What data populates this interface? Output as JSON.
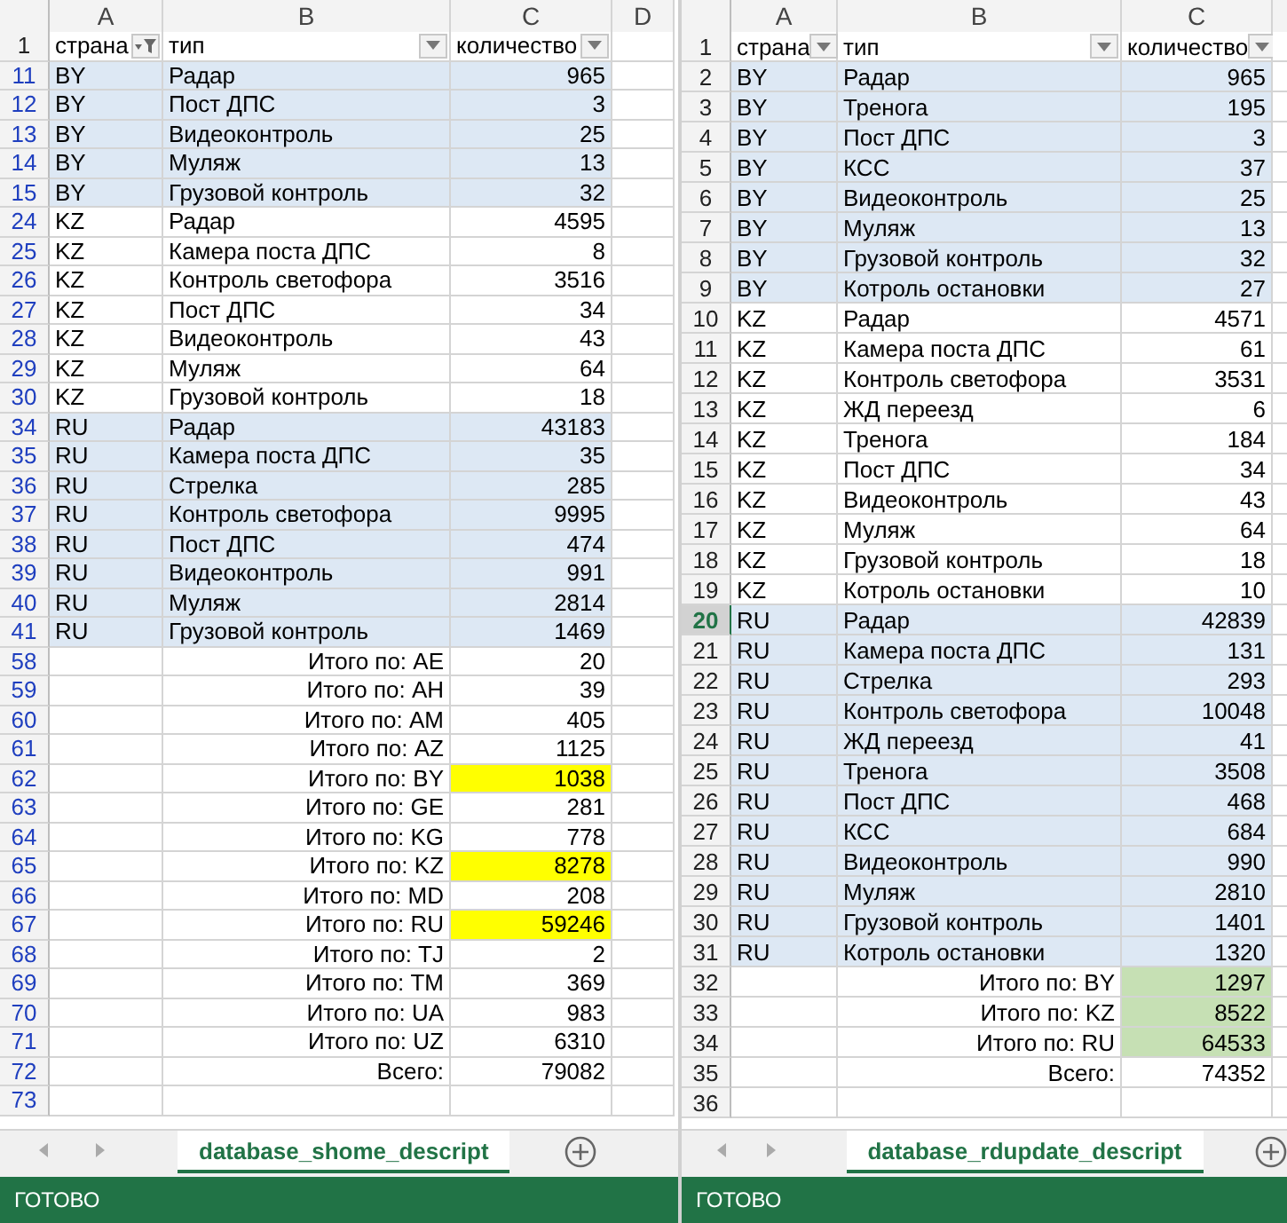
{
  "panes": [
    {
      "filtered": true,
      "column_letters": [
        "A",
        "B",
        "C",
        "D"
      ],
      "header": {
        "num": "1",
        "cells": [
          {
            "label": "страна",
            "filtered": true
          },
          {
            "label": "тип",
            "filtered": false
          },
          {
            "label": "количество",
            "filtered": false
          }
        ]
      },
      "rows": [
        {
          "num": "11",
          "kind": "data",
          "shaded": true,
          "selected": false,
          "country": "BY",
          "type": "Радар",
          "count": "965"
        },
        {
          "num": "12",
          "kind": "data",
          "shaded": true,
          "selected": false,
          "country": "BY",
          "type": "Пост ДПС",
          "count": "3"
        },
        {
          "num": "13",
          "kind": "data",
          "shaded": true,
          "selected": false,
          "country": "BY",
          "type": "Видеоконтроль",
          "count": "25"
        },
        {
          "num": "14",
          "kind": "data",
          "shaded": true,
          "selected": false,
          "country": "BY",
          "type": "Муляж",
          "count": "13"
        },
        {
          "num": "15",
          "kind": "data",
          "shaded": true,
          "selected": false,
          "country": "BY",
          "type": "Грузовой контроль",
          "count": "32"
        },
        {
          "num": "24",
          "kind": "data",
          "shaded": false,
          "selected": false,
          "country": "KZ",
          "type": "Радар",
          "count": "4595"
        },
        {
          "num": "25",
          "kind": "data",
          "shaded": false,
          "selected": false,
          "country": "KZ",
          "type": "Камера поста ДПС",
          "count": "8"
        },
        {
          "num": "26",
          "kind": "data",
          "shaded": false,
          "selected": false,
          "country": "KZ",
          "type": "Контроль светофора",
          "count": "3516"
        },
        {
          "num": "27",
          "kind": "data",
          "shaded": false,
          "selected": false,
          "country": "KZ",
          "type": "Пост ДПС",
          "count": "34"
        },
        {
          "num": "28",
          "kind": "data",
          "shaded": false,
          "selected": false,
          "country": "KZ",
          "type": "Видеоконтроль",
          "count": "43"
        },
        {
          "num": "29",
          "kind": "data",
          "shaded": false,
          "selected": false,
          "country": "KZ",
          "type": "Муляж",
          "count": "64"
        },
        {
          "num": "30",
          "kind": "data",
          "shaded": false,
          "selected": false,
          "country": "KZ",
          "type": "Грузовой контроль",
          "count": "18"
        },
        {
          "num": "34",
          "kind": "data",
          "shaded": true,
          "selected": false,
          "country": "RU",
          "type": "Радар",
          "count": "43183"
        },
        {
          "num": "35",
          "kind": "data",
          "shaded": true,
          "selected": false,
          "country": "RU",
          "type": "Камера поста ДПС",
          "count": "35"
        },
        {
          "num": "36",
          "kind": "data",
          "shaded": true,
          "selected": false,
          "country": "RU",
          "type": "Стрелка",
          "count": "285"
        },
        {
          "num": "37",
          "kind": "data",
          "shaded": true,
          "selected": false,
          "country": "RU",
          "type": "Контроль светофора",
          "count": "9995"
        },
        {
          "num": "38",
          "kind": "data",
          "shaded": true,
          "selected": false,
          "country": "RU",
          "type": "Пост ДПС",
          "count": "474"
        },
        {
          "num": "39",
          "kind": "data",
          "shaded": true,
          "selected": false,
          "country": "RU",
          "type": "Видеоконтроль",
          "count": "991"
        },
        {
          "num": "40",
          "kind": "data",
          "shaded": true,
          "selected": false,
          "country": "RU",
          "type": "Муляж",
          "count": "2814"
        },
        {
          "num": "41",
          "kind": "data",
          "shaded": true,
          "selected": false,
          "country": "RU",
          "type": "Грузовой контроль",
          "count": "1469"
        },
        {
          "num": "58",
          "kind": "total",
          "shaded": false,
          "selected": false,
          "label": "Итого по: AE",
          "value": "20"
        },
        {
          "num": "59",
          "kind": "total",
          "shaded": false,
          "selected": false,
          "label": "Итого по: AH",
          "value": "39"
        },
        {
          "num": "60",
          "kind": "total",
          "shaded": false,
          "selected": false,
          "label": "Итого по: AM",
          "value": "405"
        },
        {
          "num": "61",
          "kind": "total",
          "shaded": false,
          "selected": false,
          "label": "Итого по: AZ",
          "value": "1125"
        },
        {
          "num": "62",
          "kind": "total",
          "shaded": false,
          "selected": false,
          "label": "Итого по: BY",
          "value": "1038",
          "color": "#ffff00"
        },
        {
          "num": "63",
          "kind": "total",
          "shaded": false,
          "selected": false,
          "label": "Итого по: GE",
          "value": "281"
        },
        {
          "num": "64",
          "kind": "total",
          "shaded": false,
          "selected": false,
          "label": "Итого по: KG",
          "value": "778"
        },
        {
          "num": "65",
          "kind": "total",
          "shaded": false,
          "selected": false,
          "label": "Итого по: KZ",
          "value": "8278",
          "color": "#ffff00"
        },
        {
          "num": "66",
          "kind": "total",
          "shaded": false,
          "selected": false,
          "label": "Итого по: MD",
          "value": "208"
        },
        {
          "num": "67",
          "kind": "total",
          "shaded": false,
          "selected": false,
          "label": "Итого по: RU",
          "value": "59246",
          "color": "#ffff00"
        },
        {
          "num": "68",
          "kind": "total",
          "shaded": false,
          "selected": false,
          "label": "Итого по: TJ",
          "value": "2"
        },
        {
          "num": "69",
          "kind": "total",
          "shaded": false,
          "selected": false,
          "label": "Итого по: TM",
          "value": "369"
        },
        {
          "num": "70",
          "kind": "total",
          "shaded": false,
          "selected": false,
          "label": "Итого по: UA",
          "value": "983"
        },
        {
          "num": "71",
          "kind": "total",
          "shaded": false,
          "selected": false,
          "label": "Итого по: UZ",
          "value": "6310"
        },
        {
          "num": "72",
          "kind": "total",
          "shaded": false,
          "selected": false,
          "label": "Всего:",
          "value": "79082"
        },
        {
          "num": "73",
          "kind": "empty",
          "shaded": false,
          "selected": false
        }
      ],
      "sheet_tab": "database_shome_descript",
      "status": "ГОТОВО"
    },
    {
      "filtered": false,
      "column_letters": [
        "A",
        "B",
        "C"
      ],
      "header": {
        "num": "1",
        "cells": [
          {
            "label": "страна",
            "filtered": false
          },
          {
            "label": "тип",
            "filtered": false
          },
          {
            "label": "количество",
            "filtered": false
          }
        ]
      },
      "rows": [
        {
          "num": "2",
          "kind": "data",
          "shaded": true,
          "selected": false,
          "country": "BY",
          "type": "Радар",
          "count": "965"
        },
        {
          "num": "3",
          "kind": "data",
          "shaded": true,
          "selected": false,
          "country": "BY",
          "type": "Тренога",
          "count": "195"
        },
        {
          "num": "4",
          "kind": "data",
          "shaded": true,
          "selected": false,
          "country": "BY",
          "type": "Пост ДПС",
          "count": "3"
        },
        {
          "num": "5",
          "kind": "data",
          "shaded": true,
          "selected": false,
          "country": "BY",
          "type": "КСС",
          "count": "37"
        },
        {
          "num": "6",
          "kind": "data",
          "shaded": true,
          "selected": false,
          "country": "BY",
          "type": "Видеоконтроль",
          "count": "25"
        },
        {
          "num": "7",
          "kind": "data",
          "shaded": true,
          "selected": false,
          "country": "BY",
          "type": "Муляж",
          "count": "13"
        },
        {
          "num": "8",
          "kind": "data",
          "shaded": true,
          "selected": false,
          "country": "BY",
          "type": "Грузовой контроль",
          "count": "32"
        },
        {
          "num": "9",
          "kind": "data",
          "shaded": true,
          "selected": false,
          "country": "BY",
          "type": "Котроль остановки",
          "count": "27"
        },
        {
          "num": "10",
          "kind": "data",
          "shaded": false,
          "selected": false,
          "country": "KZ",
          "type": "Радар",
          "count": "4571"
        },
        {
          "num": "11",
          "kind": "data",
          "shaded": false,
          "selected": false,
          "country": "KZ",
          "type": "Камера поста ДПС",
          "count": "61"
        },
        {
          "num": "12",
          "kind": "data",
          "shaded": false,
          "selected": false,
          "country": "KZ",
          "type": "Контроль светофора",
          "count": "3531"
        },
        {
          "num": "13",
          "kind": "data",
          "shaded": false,
          "selected": false,
          "country": "KZ",
          "type": "ЖД переезд",
          "count": "6"
        },
        {
          "num": "14",
          "kind": "data",
          "shaded": false,
          "selected": false,
          "country": "KZ",
          "type": "Тренога",
          "count": "184"
        },
        {
          "num": "15",
          "kind": "data",
          "shaded": false,
          "selected": false,
          "country": "KZ",
          "type": "Пост ДПС",
          "count": "34"
        },
        {
          "num": "16",
          "kind": "data",
          "shaded": false,
          "selected": false,
          "country": "KZ",
          "type": "Видеоконтроль",
          "count": "43"
        },
        {
          "num": "17",
          "kind": "data",
          "shaded": false,
          "selected": false,
          "country": "KZ",
          "type": "Муляж",
          "count": "64"
        },
        {
          "num": "18",
          "kind": "data",
          "shaded": false,
          "selected": false,
          "country": "KZ",
          "type": "Грузовой контроль",
          "count": "18"
        },
        {
          "num": "19",
          "kind": "data",
          "shaded": false,
          "selected": false,
          "country": "KZ",
          "type": "Котроль остановки",
          "count": "10"
        },
        {
          "num": "20",
          "kind": "data",
          "shaded": true,
          "selected": true,
          "country": "RU",
          "type": "Радар",
          "count": "42839"
        },
        {
          "num": "21",
          "kind": "data",
          "shaded": true,
          "selected": false,
          "country": "RU",
          "type": "Камера поста ДПС",
          "count": "131"
        },
        {
          "num": "22",
          "kind": "data",
          "shaded": true,
          "selected": false,
          "country": "RU",
          "type": "Стрелка",
          "count": "293"
        },
        {
          "num": "23",
          "kind": "data",
          "shaded": true,
          "selected": false,
          "country": "RU",
          "type": "Контроль светофора",
          "count": "10048"
        },
        {
          "num": "24",
          "kind": "data",
          "shaded": true,
          "selected": false,
          "country": "RU",
          "type": "ЖД переезд",
          "count": "41"
        },
        {
          "num": "25",
          "kind": "data",
          "shaded": true,
          "selected": false,
          "country": "RU",
          "type": "Тренога",
          "count": "3508"
        },
        {
          "num": "26",
          "kind": "data",
          "shaded": true,
          "selected": false,
          "country": "RU",
          "type": "Пост ДПС",
          "count": "468"
        },
        {
          "num": "27",
          "kind": "data",
          "shaded": true,
          "selected": false,
          "country": "RU",
          "type": "КСС",
          "count": "684"
        },
        {
          "num": "28",
          "kind": "data",
          "shaded": true,
          "selected": false,
          "country": "RU",
          "type": "Видеоконтроль",
          "count": "990"
        },
        {
          "num": "29",
          "kind": "data",
          "shaded": true,
          "selected": false,
          "country": "RU",
          "type": "Муляж",
          "count": "2810"
        },
        {
          "num": "30",
          "kind": "data",
          "shaded": true,
          "selected": false,
          "country": "RU",
          "type": "Грузовой контроль",
          "count": "1401"
        },
        {
          "num": "31",
          "kind": "data",
          "shaded": true,
          "selected": false,
          "country": "RU",
          "type": "Котроль остановки",
          "count": "1320"
        },
        {
          "num": "32",
          "kind": "total",
          "shaded": false,
          "selected": false,
          "label": "Итого по: BY",
          "value": "1297",
          "color": "#c6e0b4"
        },
        {
          "num": "33",
          "kind": "total",
          "shaded": false,
          "selected": false,
          "label": "Итого по: KZ",
          "value": "8522",
          "color": "#c6e0b4"
        },
        {
          "num": "34",
          "kind": "total",
          "shaded": false,
          "selected": false,
          "label": "Итого по: RU",
          "value": "64533",
          "color": "#c6e0b4"
        },
        {
          "num": "35",
          "kind": "total",
          "shaded": false,
          "selected": false,
          "label": "Всего:",
          "value": "74352"
        },
        {
          "num": "36",
          "kind": "empty",
          "shaded": false,
          "selected": false
        }
      ],
      "sheet_tab": "database_rdupdate_descript",
      "status": "ГОТОВО"
    }
  ]
}
